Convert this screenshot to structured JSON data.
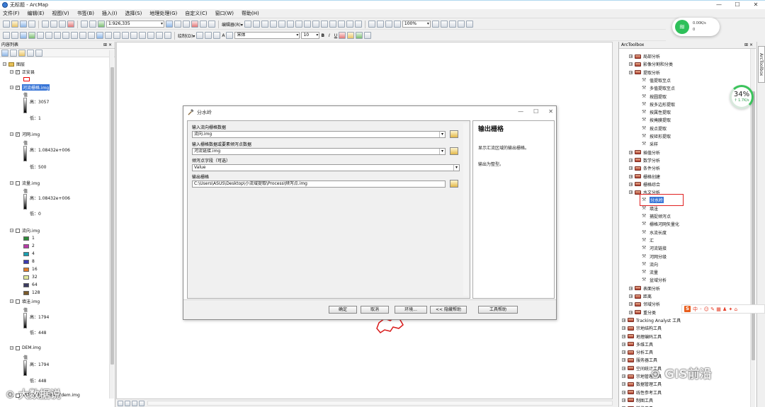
{
  "window": {
    "title": "无标题 - ArcMap",
    "min": "—",
    "max": "☐",
    "close": "✕"
  },
  "menu": [
    "文件(F)",
    "编辑(E)",
    "视图(V)",
    "书签(B)",
    "插入(I)",
    "选择(S)",
    "地理处理(G)",
    "自定义(C)",
    "窗口(W)",
    "帮助(H)"
  ],
  "toolbar": {
    "scale": "1:926,335",
    "editor": "编辑器(R)▾",
    "zoom": "100%",
    "draw": "绘制(D)▾",
    "font": "宋体",
    "font_size": "10",
    "bold": "B",
    "italic": "I",
    "underline": "U",
    "text_tool": "A"
  },
  "toc": {
    "title": "内容列表",
    "pin": "⊞ ×",
    "root": "图层",
    "layers": [
      {
        "name": "正安县",
        "checked": "✓"
      },
      {
        "name": "河流栅格.img",
        "checked": "✓",
        "value_label": "值",
        "high": "高：3057",
        "low": "低：1"
      },
      {
        "name": "河网.img",
        "checked": "✓",
        "value_label": "值",
        "high": "高：1.08432e+006",
        "low": "低：500"
      },
      {
        "name": "流量.img",
        "checked": "",
        "value_label": "值",
        "high": "高：1.08432e+006",
        "low": "低：0"
      },
      {
        "name": "流向.img",
        "checked": ""
      },
      {
        "name": "填洼.img",
        "checked": "",
        "value_label": "值",
        "high": "高：1794",
        "low": "低：448"
      },
      {
        "name": "DEM.img",
        "checked": "",
        "value_label": "值",
        "high": "高：1794",
        "low": "低：448"
      },
      {
        "name": "ASTGTM_N28E107dem.img",
        "checked": ""
      }
    ],
    "flow_classes": [
      {
        "label": "1",
        "color": "#2e8b3a"
      },
      {
        "label": "2",
        "color": "#b83aa8"
      },
      {
        "label": "4",
        "color": "#1a9fb0"
      },
      {
        "label": "8",
        "color": "#3a3ab0"
      },
      {
        "label": "16",
        "color": "#e07a28"
      },
      {
        "label": "32",
        "color": "#e0e89a"
      },
      {
        "label": "64",
        "color": "#3c3c60"
      },
      {
        "label": "128",
        "color": "#7a5a2a"
      }
    ]
  },
  "dialog": {
    "title": "分水岭",
    "fields": [
      {
        "label": "输入流向栅格数据",
        "value": "流向.img"
      },
      {
        "label": "输入栅格数据或要素倾泻点数据",
        "value": "河流链接.img"
      },
      {
        "label": "倾泻点字段（可选）",
        "value": "Value"
      },
      {
        "label": "输出栅格",
        "value": "C:\\Users\\ASUS\\Desktop\\小流域提取\\Process\\倾泻点.img"
      }
    ],
    "help_title": "输出栅格",
    "help_lines": [
      "显示汇流区域的输出栅格。",
      "输出为整型。"
    ],
    "buttons": {
      "ok": "确定",
      "cancel": "取消",
      "env": "环境...",
      "hide_help": "<< 隐藏帮助",
      "tool_help": "工具帮助"
    }
  },
  "arctoolbox": {
    "title": "ArcToolbox",
    "side_tab": "ArcToolbox",
    "items": [
      {
        "label": "局部分析",
        "kind": "box",
        "indent": 1
      },
      {
        "label": "影像分割和分类",
        "kind": "box",
        "indent": 1
      },
      {
        "label": "提取分析",
        "kind": "box",
        "indent": 1
      },
      {
        "label": "值提取至点",
        "kind": "tool",
        "indent": 2
      },
      {
        "label": "多值提取至点",
        "kind": "tool",
        "indent": 2
      },
      {
        "label": "按圆提取",
        "kind": "tool",
        "indent": 2
      },
      {
        "label": "按多边形提取",
        "kind": "tool",
        "indent": 2
      },
      {
        "label": "按属性提取",
        "kind": "tool",
        "indent": 2
      },
      {
        "label": "按掩膜提取",
        "kind": "tool",
        "indent": 2
      },
      {
        "label": "按点提取",
        "kind": "tool",
        "indent": 2
      },
      {
        "label": "按矩形提取",
        "kind": "tool",
        "indent": 2
      },
      {
        "label": "采样",
        "kind": "tool",
        "indent": 2
      },
      {
        "label": "插值分析",
        "kind": "box",
        "indent": 1
      },
      {
        "label": "数学分析",
        "kind": "box",
        "indent": 1
      },
      {
        "label": "条件分析",
        "kind": "box",
        "indent": 1
      },
      {
        "label": "栅格创建",
        "kind": "box",
        "indent": 1
      },
      {
        "label": "栅格综合",
        "kind": "box",
        "indent": 1
      },
      {
        "label": "水文分析",
        "kind": "box",
        "indent": 1
      },
      {
        "label": "分水岭",
        "kind": "tool",
        "indent": 2,
        "selected": true
      },
      {
        "label": "填洼",
        "kind": "tool",
        "indent": 2
      },
      {
        "label": "捕捉倾泻点",
        "kind": "tool",
        "indent": 2
      },
      {
        "label": "栅格河网矢量化",
        "kind": "tool",
        "indent": 2
      },
      {
        "label": "水流长度",
        "kind": "tool",
        "indent": 2
      },
      {
        "label": "汇",
        "kind": "tool",
        "indent": 2
      },
      {
        "label": "河流链接",
        "kind": "tool",
        "indent": 2
      },
      {
        "label": "河网分级",
        "kind": "tool",
        "indent": 2
      },
      {
        "label": "流向",
        "kind": "tool",
        "indent": 2
      },
      {
        "label": "流量",
        "kind": "tool",
        "indent": 2
      },
      {
        "label": "盆域分析",
        "kind": "tool",
        "indent": 2
      },
      {
        "label": "表面分析",
        "kind": "box",
        "indent": 1
      },
      {
        "label": "距离",
        "kind": "box",
        "indent": 1
      },
      {
        "label": "邻域分析",
        "kind": "box",
        "indent": 1
      },
      {
        "label": "重分类",
        "kind": "box",
        "indent": 1
      },
      {
        "label": "Tracking Analyst 工具",
        "kind": "box",
        "indent": 0
      },
      {
        "label": "宗地结构工具",
        "kind": "box",
        "indent": 0
      },
      {
        "label": "地理编码工具",
        "kind": "box",
        "indent": 0
      },
      {
        "label": "多维工具",
        "kind": "box",
        "indent": 0
      },
      {
        "label": "分析工具",
        "kind": "box",
        "indent": 0
      },
      {
        "label": "服务器工具",
        "kind": "box",
        "indent": 0
      },
      {
        "label": "空间统计工具",
        "kind": "box",
        "indent": 0
      },
      {
        "label": "宗地管理工具",
        "kind": "box",
        "indent": 0
      },
      {
        "label": "数据管理工具",
        "kind": "box",
        "indent": 0
      },
      {
        "label": "线性参考工具",
        "kind": "box",
        "indent": 0
      },
      {
        "label": "制图工具",
        "kind": "box",
        "indent": 0
      },
      {
        "label": "转换工具",
        "kind": "box",
        "indent": 0
      }
    ]
  },
  "overlays": {
    "net_up": "0.00K/s",
    "net_down": "0",
    "cpu_percent": "34%",
    "cpu_speed": "↑ 1.7K/s",
    "ime_brand": "S",
    "ime_tools": "中 ◦ ☺ ✎ ▦ ♟ ✦ ⌂",
    "watermark_left": "大数据说",
    "watermark_right": "GIS前沿",
    "watermark_logo": "⊛"
  },
  "colors": {
    "selection_red": "#e02020",
    "map_feature": "#d91a1a",
    "accent_green": "#2ec05a"
  }
}
